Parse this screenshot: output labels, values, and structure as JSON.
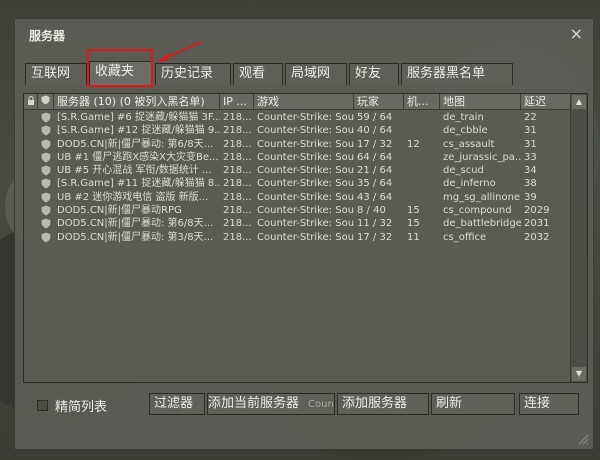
{
  "window": {
    "title": "服务器",
    "close_label": "×"
  },
  "tabs": [
    {
      "label": "互联网",
      "active": false
    },
    {
      "label": "收藏夹",
      "active": true
    },
    {
      "label": "历史记录",
      "active": false
    },
    {
      "label": "观看",
      "active": false
    },
    {
      "label": "局域网",
      "active": false
    },
    {
      "label": "好友",
      "active": false
    },
    {
      "label": "服务器黑名单",
      "active": false
    }
  ],
  "columns": {
    "servers": "服务器 (10) (0 被列入黑名单)",
    "ip": "IP ...",
    "game": "游戏",
    "players": "玩家",
    "bots": "机...",
    "map": "地图",
    "latency": "延迟"
  },
  "servers": [
    {
      "name": "[S.R.Game] #6 捉迷藏/躲猫猫 3F...",
      "ip": "218...",
      "game": "Counter-Strike: Sou...",
      "players": "59 / 64",
      "bots": "",
      "map": "de_train",
      "latency": "22"
    },
    {
      "name": "[S.R.Game] #12 捉迷藏/躲猫猫 9...",
      "ip": "218...",
      "game": "Counter-Strike: Sou...",
      "players": "40 / 64",
      "bots": "",
      "map": "de_cbble",
      "latency": "31"
    },
    {
      "name": "DOD5.CN|新|僵尸暴动: 第6/8天...",
      "ip": "218...",
      "game": "Counter-Strike: Sou...",
      "players": "17 / 32",
      "bots": "12",
      "map": "cs_assault",
      "latency": "31"
    },
    {
      "name": "UB #1 僵尸逃跑X感染X大灾变Be...",
      "ip": "218...",
      "game": "Counter-Strike: Sou...",
      "players": "64 / 64",
      "bots": "",
      "map": "ze_jurassic_pa...",
      "latency": "33"
    },
    {
      "name": "UB #5 开心混战 军衔/数据统计 ...",
      "ip": "218...",
      "game": "Counter-Strike: Sou...",
      "players": "21 / 64",
      "bots": "",
      "map": "de_scud",
      "latency": "34"
    },
    {
      "name": "[S.R.Game] #11 捉迷藏/躲猫猫 8...",
      "ip": "218...",
      "game": "Counter-Strike: Sou...",
      "players": "35 / 64",
      "bots": "",
      "map": "de_inferno",
      "latency": "38"
    },
    {
      "name": "UB #2 迷你游戏电信 盗版 新版...",
      "ip": "218...",
      "game": "Counter-Strike: Sou...",
      "players": "43 / 64",
      "bots": "",
      "map": "mg_sg_allinone...",
      "latency": "39"
    },
    {
      "name": "DOD5.CN|新|僵尸暴动RPG",
      "ip": "218...",
      "game": "Counter-Strike: Sou...",
      "players": "8 / 40",
      "bots": "15",
      "map": "cs_compound",
      "latency": "2029"
    },
    {
      "name": "DOD5.CN|新|僵尸暴动: 第6/8天...",
      "ip": "218...",
      "game": "Counter-Strike: Sou...",
      "players": "11 / 32",
      "bots": "15",
      "map": "de_battlebridge",
      "latency": "2031"
    },
    {
      "name": "DOD5.CN|新|僵尸暴动: 第3/8天...",
      "ip": "218...",
      "game": "Counter-Strike: Sou...",
      "players": "17 / 32",
      "bots": "11",
      "map": "cs_office",
      "latency": "2032"
    }
  ],
  "footer": {
    "compact_list_label": "精简列表",
    "filter_button": "过滤器",
    "add_current_server_button": "添加当前服务器",
    "add_current_server_ghost": "Counter-Strik...",
    "add_server_button": "添加服务器",
    "refresh_button": "刷新",
    "connect_button": "连接"
  },
  "scroll": {
    "up": "▲",
    "down": "▼"
  },
  "icons": {
    "lock_column": "lock-icon",
    "shield_column": "shield-icon",
    "row_status": "shield-icon"
  },
  "colors": {
    "highlight_box": "#e01818",
    "dialog_bg": "#5c5e56",
    "text": "#ececec"
  }
}
